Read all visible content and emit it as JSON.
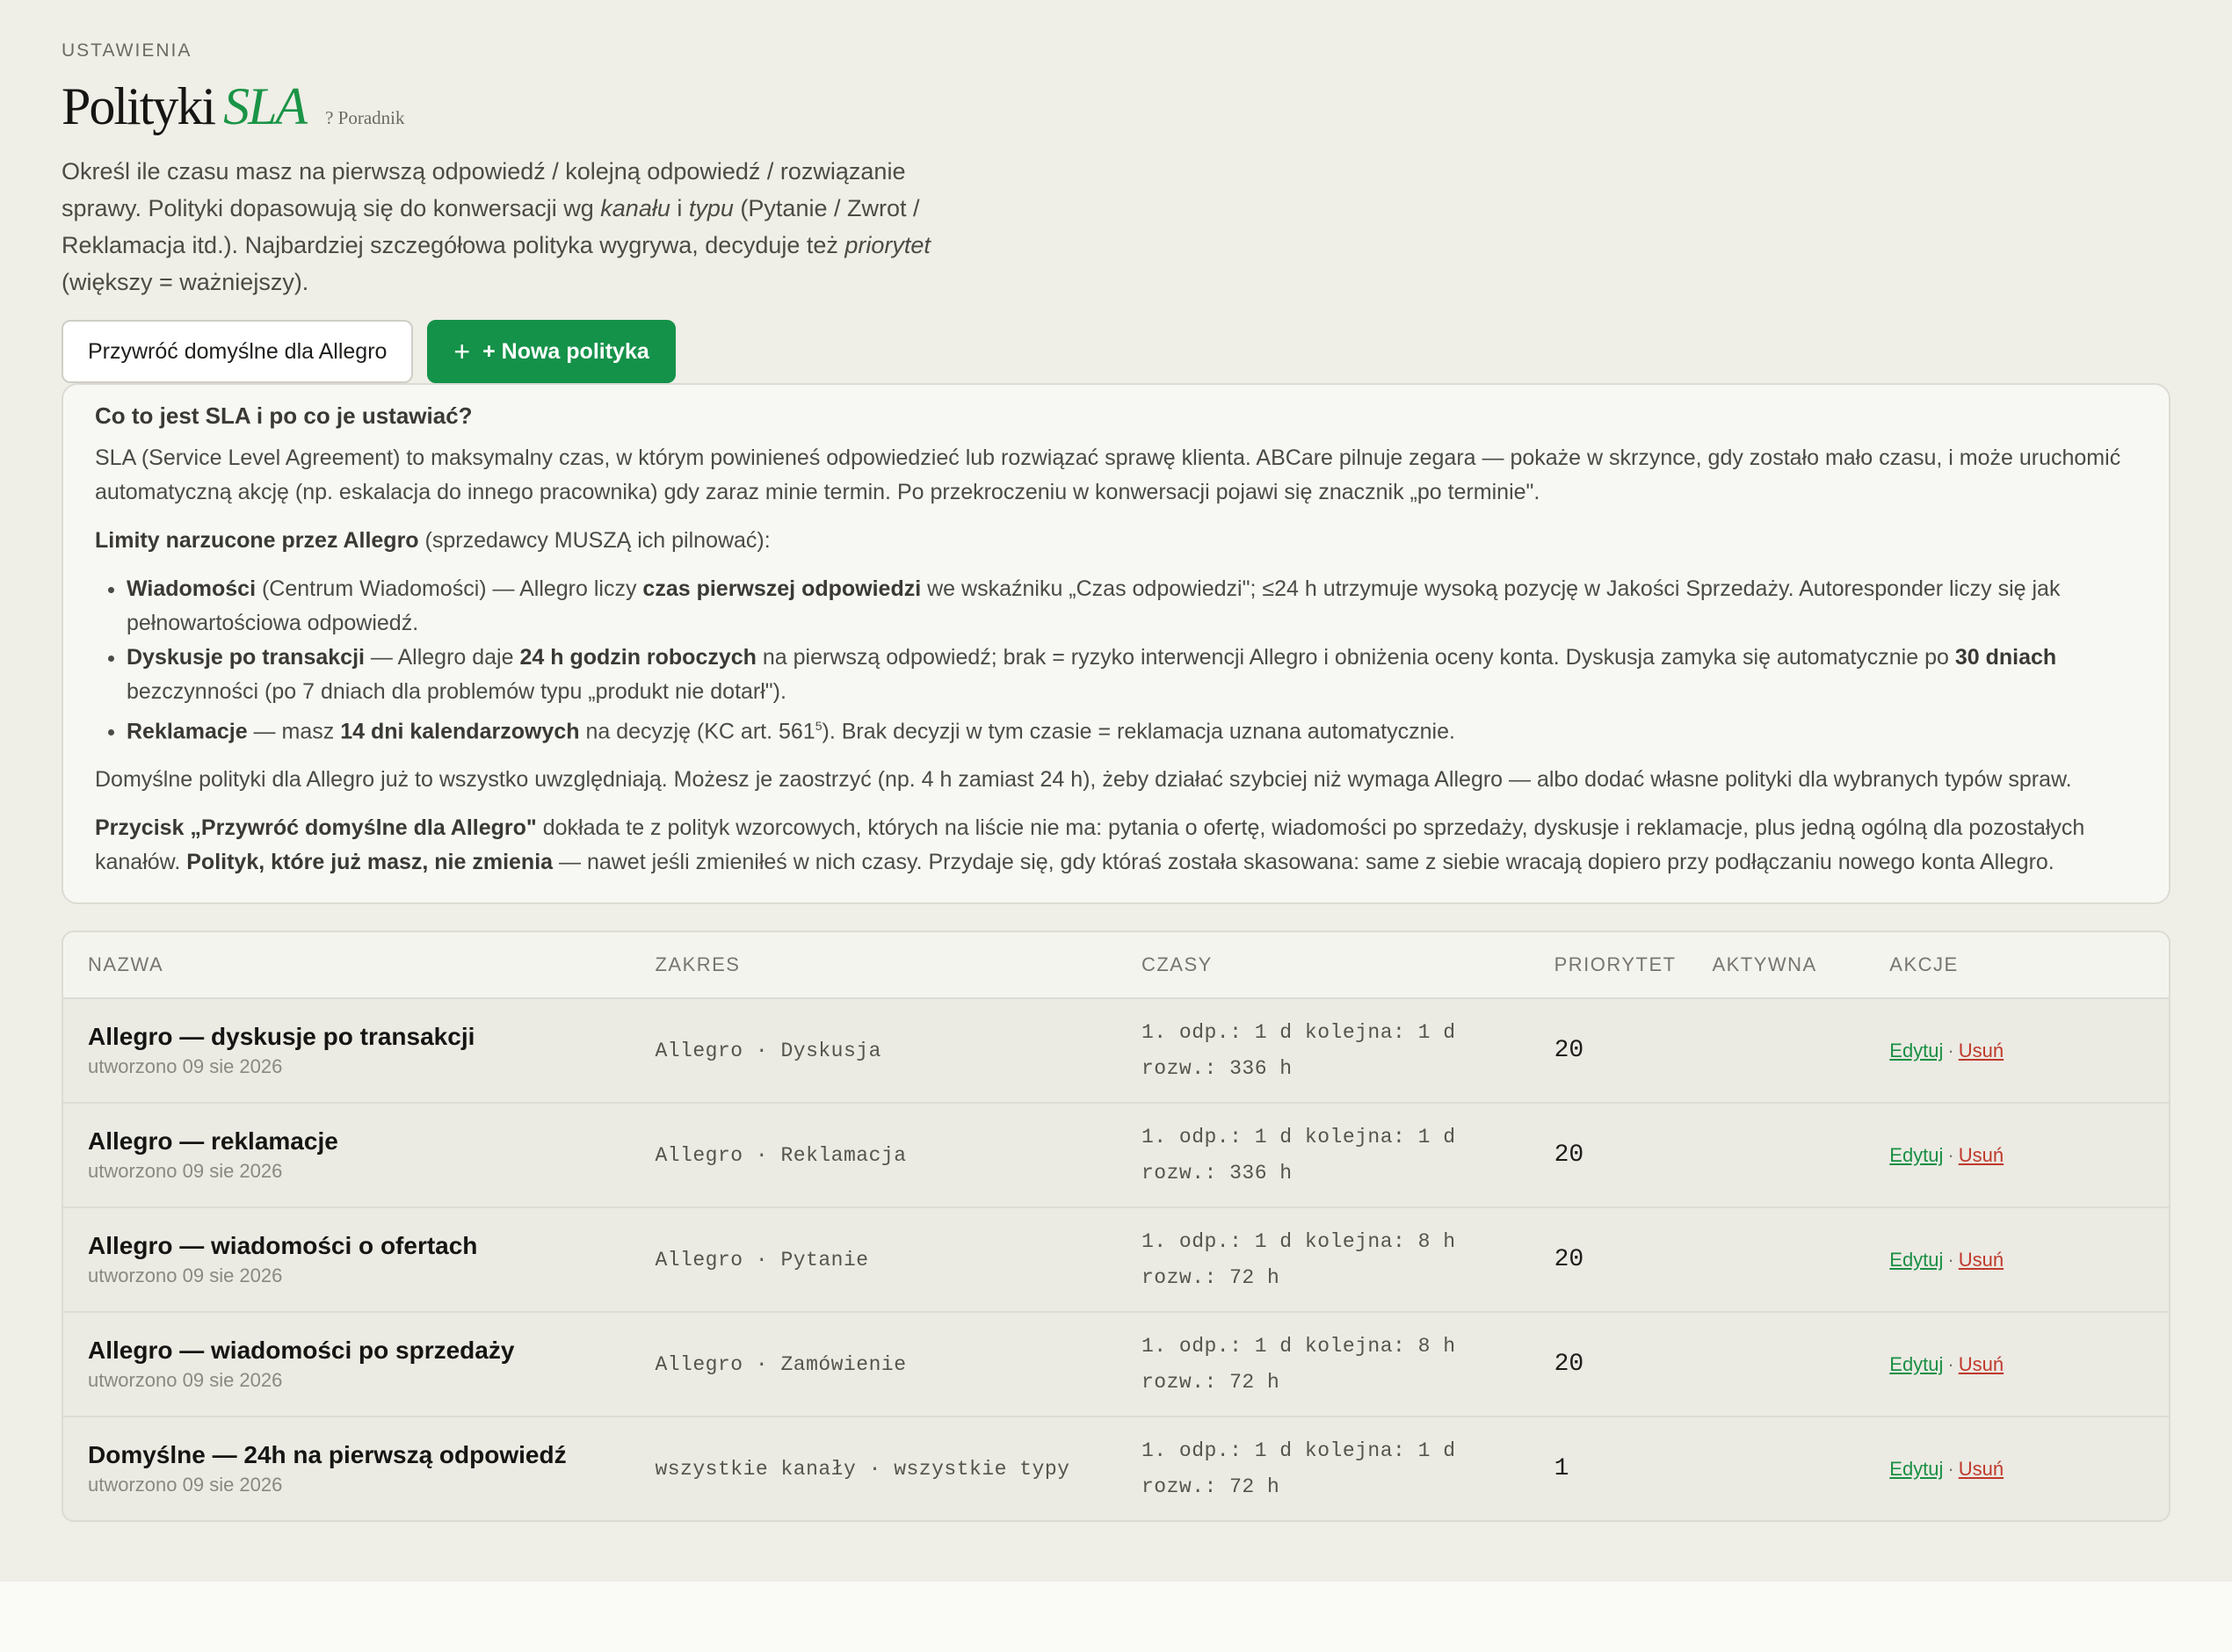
{
  "header": {
    "eyebrow": "USTAWIENIA",
    "title_main": "Polityki",
    "title_accent": "SLA",
    "guide_link": "? Poradnik",
    "intro": {
      "p1": "Określ ile czasu masz na pierwszą odpowiedź / kolejną odpowiedź / rozwiązanie sprawy. Polityki dopasowują się do konwersacji wg ",
      "em1": "kanału",
      "p2": " i ",
      "em2": "typu",
      "p3": " (Pytanie / Zwrot / Reklamacja itd.). Najbardziej szczegółowa polityka wygrywa, decyduje też ",
      "em3": "priorytet",
      "p4": " (większy = ważniejszy)."
    }
  },
  "buttons": {
    "restore": "Przywróć domyślne dla Allegro",
    "new_plus": "+",
    "new_label": "+ Nowa polityka"
  },
  "info": {
    "heading": "Co to jest SLA i po co je ustawiać?",
    "p1": "SLA (Service Level Agreement) to maksymalny czas, w którym powinieneś odpowiedzieć lub rozwiązać sprawę klienta. ABCare pilnuje zegara — pokaże w skrzynce, gdy zostało mało czasu, i może uruchomić automatyczną akcję (np. eskalacja do innego pracownika) gdy zaraz minie termin. Po przekroczeniu w konwersacji pojawi się znacznik „po terminie\".",
    "limits_bold": "Limity narzucone przez Allegro",
    "limits_rest": " (sprzedawcy MUSZĄ ich pilnować):",
    "b1_bold": "Wiadomości",
    "b1_a": " (Centrum Wiadomości) — Allegro liczy ",
    "b1_bold2": "czas pierwszej odpowiedzi",
    "b1_b": " we wskaźniku „Czas odpowiedzi\"; ≤24 h utrzymuje wysoką pozycję w Jakości Sprzedaży. Autoresponder liczy się jak pełnowartościowa odpowiedź.",
    "b2_bold": "Dyskusje po transakcji",
    "b2_a": " — Allegro daje ",
    "b2_bold2": "24 h godzin roboczych",
    "b2_b": " na pierwszą odpowiedź; brak = ryzyko interwencji Allegro i obniżenia oceny konta. Dyskusja zamyka się automatycznie po ",
    "b2_bold3": "30 dniach",
    "b2_c": " bezczynności (po 7 dniach dla problemów typu „produkt nie dotarł\").",
    "b3_bold": "Reklamacje",
    "b3_a": " — masz ",
    "b3_bold2": "14 dni kalendarzowych",
    "b3_b": " na decyzję (KC art. 561",
    "b3_sup": "5",
    "b3_c": "). Brak decyzji w tym czasie = reklamacja uznana automatycznie.",
    "p3": "Domyślne polityki dla Allegro już to wszystko uwzględniają. Możesz je zaostrzyć (np. 4 h zamiast 24 h), żeby działać szybciej niż wymaga Allegro — albo dodać własne polityki dla wybranych typów spraw.",
    "p4_bold": "Przycisk „Przywróć domyślne dla Allegro\"",
    "p4_a": " dokłada te z polityk wzorcowych, których na liście nie ma: pytania o ofertę, wiadomości po sprzedaży, dyskusje i reklamacje, plus jedną ogólną dla pozostałych kanałów. ",
    "p4_bold2": "Polityk, które już masz, nie zmienia",
    "p4_b": " — nawet jeśli zmieniłeś w nich czasy. Przydaje się, gdy któraś została skasowana: same z siebie wracają dopiero przy podłączaniu nowego konta Allegro."
  },
  "table": {
    "headers": {
      "name": "NAZWA",
      "scope": "ZAKRES",
      "times": "CZASY",
      "priority": "PRIORYTET",
      "active": "AKTYWNA",
      "actions": "AKCJE"
    },
    "edit_label": "Edytuj",
    "delete_label": "Usuń",
    "separator": "·",
    "rows": [
      {
        "name": "Allegro — dyskusje po transakcji",
        "created": "utworzono 09 sie 2026",
        "scope": "Allegro · Dyskusja",
        "times_line1": "1. odp.: 1 d kolejna: 1 d",
        "times_line2": "rozw.: 336 h",
        "priority": "20"
      },
      {
        "name": "Allegro — reklamacje",
        "created": "utworzono 09 sie 2026",
        "scope": "Allegro · Reklamacja",
        "times_line1": "1. odp.: 1 d kolejna: 1 d",
        "times_line2": "rozw.: 336 h",
        "priority": "20"
      },
      {
        "name": "Allegro — wiadomości o ofertach",
        "created": "utworzono 09 sie 2026",
        "scope": "Allegro · Pytanie",
        "times_line1": "1. odp.: 1 d kolejna: 8 h",
        "times_line2": "rozw.: 72 h",
        "priority": "20"
      },
      {
        "name": "Allegro — wiadomości po sprzedaży",
        "created": "utworzono 09 sie 2026",
        "scope": "Allegro · Zamówienie",
        "times_line1": "1. odp.: 1 d kolejna: 8 h",
        "times_line2": "rozw.: 72 h",
        "priority": "20"
      },
      {
        "name": "Domyślne — 24h na pierwszą odpowiedź",
        "created": "utworzono 09 sie 2026",
        "scope": "wszystkie kanały · wszystkie typy",
        "times_line1": "1. odp.: 1 d kolejna: 1 d",
        "times_line2": "rozw.: 72 h",
        "priority": "1"
      }
    ]
  }
}
